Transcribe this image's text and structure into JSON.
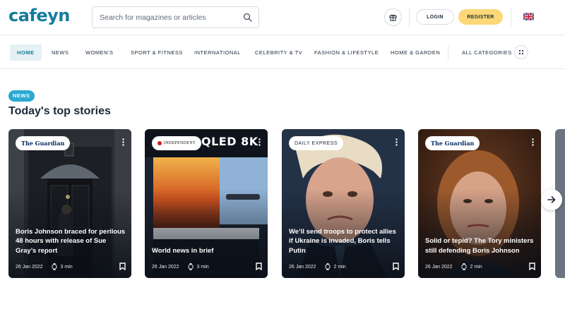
{
  "brand": {
    "logo": "cafeyn"
  },
  "search": {
    "placeholder": "Search for magazines or articles",
    "icon": "search-icon"
  },
  "header": {
    "login_label": "LOGIN",
    "register_label": "REGISTER",
    "gift_icon": "gift-icon",
    "flag_icon": "uk-flag-icon"
  },
  "nav": {
    "items": [
      {
        "label": "HOME",
        "active": true
      },
      {
        "label": "NEWS"
      },
      {
        "label": "WOMEN'S"
      },
      {
        "label": "SPORT & FITNESS"
      },
      {
        "label": "INTERNATIONAL"
      },
      {
        "label": "CELEBRITY & TV"
      },
      {
        "label": "FASHION & LIFESTYLE"
      },
      {
        "label": "HOME & GARDEN"
      }
    ],
    "all_categories": "ALL CATEGORIES"
  },
  "section": {
    "badge": "NEWS",
    "title": "Today's top stories"
  },
  "cards": [
    {
      "publisher": "The Guardian",
      "title": "Boris Johnson braced for perilous 48 hours with release of Sue Gray’s report",
      "date": "26 Jan 2022",
      "read_time": "3 min"
    },
    {
      "publisher": "INDEPENDENT",
      "title": "World news in brief",
      "date": "26 Jan 2022",
      "read_time": "3 min",
      "image_text": "QLED 8K"
    },
    {
      "publisher": "DAILY EXPRESS",
      "title": "We’ll send troops to protect allies if Ukraine is invaded, Boris tells Putin",
      "date": "26 Jan 2022",
      "read_time": "2 min"
    },
    {
      "publisher": "The Guardian",
      "title": "Solid or tepid? The Tory ministers still defending Boris Johnson",
      "date": "26 Jan 2022",
      "read_time": "2 min"
    }
  ],
  "colors": {
    "brand": "#137c9d",
    "register": "#fcd878",
    "news_badge": "#2aa9d2"
  }
}
